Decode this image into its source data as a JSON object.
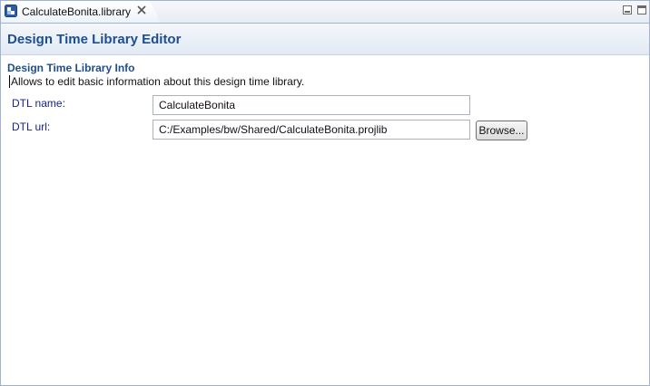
{
  "tab": {
    "label": "CalculateBonita.library"
  },
  "header": {
    "title": "Design Time Library Editor"
  },
  "section": {
    "title": "Design Time Library Info",
    "description": "Allows to edit basic information about this design time library."
  },
  "form": {
    "name_label": "DTL name:",
    "name_value": "CalculateBonita",
    "url_label": "DTL url:",
    "url_value": "C:/Examples/bw/Shared/CalculateBonita.projlib",
    "browse_label": "Browse..."
  },
  "colors": {
    "header_text": "#1f4e8c",
    "label_text": "#1a237e",
    "border": "#9fb4cf"
  }
}
